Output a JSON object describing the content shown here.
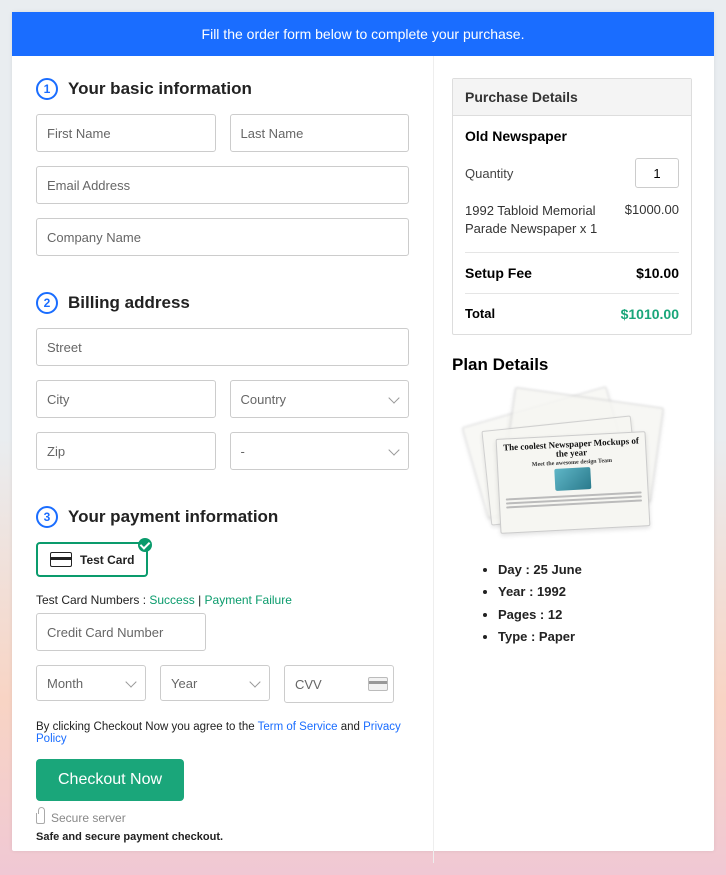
{
  "banner": "Fill the order form below to complete your purchase.",
  "sections": {
    "basic": {
      "step": "1",
      "title": "Your basic information",
      "first_name": "First Name",
      "last_name": "Last Name",
      "email": "Email Address",
      "company": "Company Name"
    },
    "billing": {
      "step": "2",
      "title": "Billing address",
      "street": "Street",
      "city": "City",
      "country": "Country",
      "zip": "Zip",
      "state": "-"
    },
    "payment": {
      "step": "3",
      "title": "Your payment information",
      "card_option": "Test Card",
      "test_prefix": "Test Card Numbers : ",
      "success": "Success",
      "sep": " | ",
      "failure": "Payment Failure",
      "ccnum": "Credit Card Number",
      "month": "Month",
      "year": "Year",
      "cvv": "CVV",
      "agree_pre": "By clicking Checkout Now you agree to the ",
      "tos": "Term of Service",
      "and": " and ",
      "pp": "Privacy Policy",
      "checkout": "Checkout Now",
      "secure": "Secure server",
      "safe": "Safe and secure payment checkout."
    }
  },
  "purchase": {
    "heading": "Purchase Details",
    "product": "Old Newspaper",
    "qty_label": "Quantity",
    "qty_value": "1",
    "line_name": "1992 Tabloid Memorial Parade Newspaper x 1",
    "line_price": "$1000.00",
    "fee_label": "Setup Fee",
    "fee_price": "$10.00",
    "total_label": "Total",
    "total_price": "$1010.00"
  },
  "plan": {
    "title": "Plan Details",
    "illu_headline": "The coolest Newspaper Mockups of the year",
    "illu_sub": "Meet the awesome design Team",
    "day": "Day : 25 June",
    "year": "Year : 1992",
    "pages": "Pages : 12",
    "type": "Type : Paper"
  }
}
